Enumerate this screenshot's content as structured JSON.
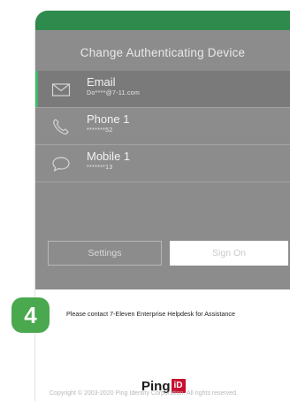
{
  "header": {
    "title": "Change Authenticating Device"
  },
  "devices": [
    {
      "name": "Email",
      "detail": "Do****@7-11.com",
      "icon": "envelope-icon",
      "selected": true
    },
    {
      "name": "Phone 1",
      "detail": "*******52",
      "icon": "phone-icon",
      "selected": false
    },
    {
      "name": "Mobile 1",
      "detail": "*******13",
      "icon": "chat-bubble-icon",
      "selected": false
    }
  ],
  "buttons": {
    "settings": "Settings",
    "sign_on": "Sign On"
  },
  "step": {
    "number": "4"
  },
  "assistance_text": "Please contact 7-Eleven Enterprise Helpdesk for Assistance",
  "logo": {
    "part1": "Ping",
    "part2": "iD"
  },
  "copyright": "Copyright © 2003-2020 Ping Identity Corporation. All rights reserved.",
  "colors": {
    "brand_green": "#2f8a4e",
    "selected_accent": "#42b96a",
    "badge_green": "#4aa84e",
    "panel_gray": "#8c8c8c",
    "logo_red": "#c8102e"
  }
}
